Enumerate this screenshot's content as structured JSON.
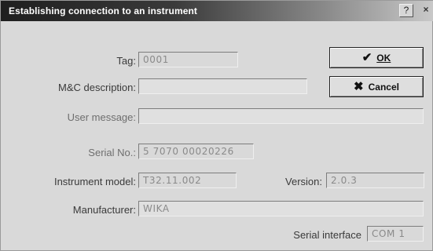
{
  "window": {
    "title": "Establishing connection to an instrument",
    "help_icon": "?",
    "close_icon": "×"
  },
  "buttons": {
    "ok": {
      "icon": "✔",
      "label": "OK"
    },
    "cancel": {
      "icon": "✖",
      "label": "Cancel"
    }
  },
  "fields": {
    "tag": {
      "label": "Tag:",
      "value": "0001"
    },
    "mc_description": {
      "label": "M&C description:",
      "value": ""
    },
    "user_message": {
      "label": "User message:",
      "value": ""
    },
    "serial_no": {
      "label": "Serial No.:",
      "value": "5 7070 00020226"
    },
    "instrument_model": {
      "label": "Instrument model:",
      "value": "T32.11.002"
    },
    "version": {
      "label": "Version:",
      "value": "2.0.3"
    },
    "manufacturer": {
      "label": "Manufacturer:",
      "value": "WIKA"
    },
    "serial_interface": {
      "label": "Serial interface",
      "value": "COM 1"
    }
  }
}
